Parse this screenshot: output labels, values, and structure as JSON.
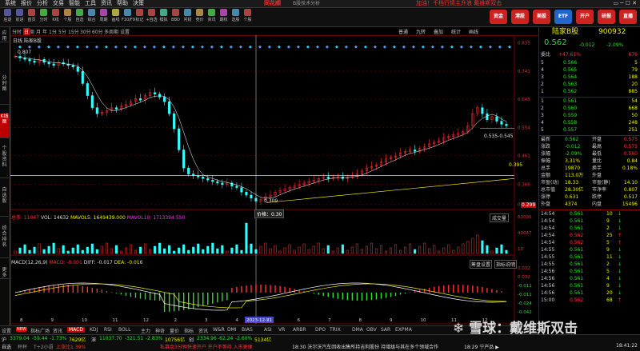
{
  "menubar": {
    "items": [
      "系统",
      "报价",
      "分析",
      "交易",
      "智能",
      "工具",
      "资讯",
      "帮助",
      "决策"
    ],
    "brand": "同花顺",
    "subtitle": "B股技术分析",
    "ad": "加油！千档行情主升浪  戴维斯双击"
  },
  "toolbar": {
    "buttons": [
      {
        "label": "后退",
        "icon": "back-icon"
      },
      {
        "label": "前进",
        "icon": "forward-icon"
      },
      {
        "label": "首页",
        "icon": "home-icon"
      },
      {
        "label": "分时",
        "icon": "timeshare-icon"
      },
      {
        "label": "K线",
        "icon": "kline-icon"
      },
      {
        "label": "个股",
        "icon": "stock-icon"
      },
      {
        "label": "自选",
        "icon": "watchlist-icon"
      },
      {
        "label": "综合",
        "icon": "composite-icon"
      },
      {
        "label": "周期",
        "icon": "period-icon"
      },
      {
        "label": "画线",
        "icon": "draw-icon"
      },
      {
        "label": "F10/F9",
        "icon": "f10-icon"
      },
      {
        "label": "标记",
        "icon": "mark-icon"
      },
      {
        "label": "+自选",
        "icon": "add-watch-icon"
      },
      {
        "label": "模拟",
        "icon": "simulate-icon"
      },
      {
        "label": "BBD",
        "icon": "bbd-icon"
      },
      {
        "label": "问财",
        "icon": "wencai-icon"
      },
      {
        "label": "竞价",
        "icon": "auction-icon"
      },
      {
        "label": "资讯",
        "icon": "news-icon"
      },
      {
        "label": "期权",
        "icon": "option-icon"
      },
      {
        "label": "选股",
        "icon": "select-icon"
      },
      {
        "label": "个股",
        "icon": "stock2-icon"
      }
    ],
    "right_buttons": [
      {
        "label": "资金",
        "color": "#c22"
      },
      {
        "label": "港股",
        "color": "#c22"
      },
      {
        "label": "美股",
        "color": "#c22"
      },
      {
        "label": "ETF",
        "color": "#26c"
      },
      {
        "label": "开户",
        "color": "#c22"
      },
      {
        "label": "研报",
        "color": "#c22"
      },
      {
        "label": "直播",
        "color": "#c22"
      }
    ]
  },
  "sidebar": [
    {
      "label": "应用",
      "active": false
    },
    {
      "label": "分时图",
      "active": false
    },
    {
      "label": "K线图",
      "active": true
    },
    {
      "label": "个股资料",
      "active": false
    },
    {
      "label": "自选股",
      "active": false
    },
    {
      "label": "综合排名",
      "active": false
    },
    {
      "label": "更多",
      "active": false
    }
  ],
  "periods": [
    "分时",
    "日",
    "周",
    "月",
    "年",
    "1分",
    "5分",
    "15分",
    "30分",
    "60分",
    "多周期",
    "设置"
  ],
  "period_active": "日",
  "period_right": [
    "普通",
    "九转",
    "叠加",
    "统计",
    "画线"
  ],
  "main_label": "日线  陆家B股",
  "chart_data": {
    "type": "candlestick",
    "y_ticks": [
      "0.835",
      "0.741",
      "0.648",
      "0.554",
      "0.461",
      "0.366",
      "0.299"
    ],
    "ylim": [
      0.285,
      0.855
    ],
    "x_ticks": [
      "8",
      "9",
      "10",
      "11",
      "12",
      "2",
      "3",
      "4",
      "5",
      "6",
      "7",
      "8",
      "9",
      "10",
      "11",
      "12"
    ],
    "x_tick_years": {
      "2023": 4
    },
    "cursor_date": "2023-12-21",
    "labels": {
      "high_mark": "0.807",
      "low_mark": "0.309",
      "range_text": "0.535-0.545",
      "price_tag": "0.395",
      "low_tag": "0.299"
    },
    "closes": [
      0.79,
      0.785,
      0.78,
      0.775,
      0.77,
      0.78,
      0.77,
      0.765,
      0.76,
      0.77,
      0.765,
      0.76,
      0.755,
      0.74,
      0.7,
      0.66,
      0.62,
      0.6,
      0.605,
      0.61,
      0.62,
      0.615,
      0.625,
      0.63,
      0.64,
      0.65,
      0.645,
      0.66,
      0.67,
      0.665,
      0.655,
      0.64,
      0.6,
      0.55,
      0.48,
      0.42,
      0.4,
      0.395,
      0.39,
      0.385,
      0.38,
      0.375,
      0.37,
      0.365,
      0.37,
      0.36,
      0.355,
      0.34,
      0.33,
      0.32,
      0.31,
      0.315,
      0.325,
      0.33,
      0.34,
      0.345,
      0.35,
      0.355,
      0.36,
      0.365,
      0.37,
      0.375,
      0.38,
      0.385,
      0.39,
      0.385,
      0.39,
      0.39,
      0.385,
      0.39,
      0.395,
      0.4,
      0.41,
      0.42,
      0.425,
      0.43,
      0.44,
      0.45,
      0.455,
      0.46,
      0.47,
      0.475,
      0.48,
      0.475,
      0.485,
      0.49,
      0.5,
      0.505,
      0.51,
      0.52,
      0.525,
      0.53,
      0.535,
      0.54,
      0.56,
      0.6,
      0.62,
      0.6,
      0.58,
      0.59,
      0.575,
      0.565,
      0.56
    ]
  },
  "volume_info": {
    "total": "总手: 11047",
    "vol": "VOL: 14632",
    "mavol5": "MAVOL5: 1649439.000",
    "mavol10": "MAVOL10: 1713394.550",
    "right": "成交量",
    "ticks": [
      "60095",
      "40047",
      "10"
    ]
  },
  "macd_info": {
    "label": "MACD(12,26,9)",
    "macd": "MACD: -0.001",
    "diff": "DIFF: -0.017",
    "dea": "DEA: -0.016",
    "btn1": "筹盘设置",
    "btn2": "指标说明",
    "ticks": [
      "0.032",
      "0.032",
      "-0.011",
      "-0.011",
      "-0.024",
      "-0.042"
    ],
    "cursor_tag": "0.30"
  },
  "bottom_tabs": [
    "设置",
    "NEW",
    "指标广场",
    "资讯",
    "MACD",
    "KDJ",
    "RSI",
    "BOLL",
    "主力",
    "神奇",
    "量价",
    "指标",
    "资讯",
    "W&R",
    "DMI",
    "BIAS",
    "ASI",
    "VR",
    "ARBR",
    "DPO",
    "TRIX",
    "DMA",
    "OBV",
    "SAR",
    "EXPMA"
  ],
  "bottom_active": "MACD",
  "quote": {
    "name": "陆家B股",
    "code": "900932",
    "price": "0.562",
    "change": "-0.012",
    "change_pct": "-2.09%",
    "weibi_label": "委比",
    "weibi": "+47.61%",
    "weicha": "676",
    "sells": [
      {
        "label": "5",
        "price": "0.566",
        "vol": "5"
      },
      {
        "label": "4",
        "price": "0.565",
        "vol": "79"
      },
      {
        "label": "3",
        "price": "0.564",
        "vol": "188"
      },
      {
        "label": "2",
        "price": "0.563",
        "vol": "20"
      },
      {
        "label": "1",
        "price": "0.562",
        "vol": "885"
      }
    ],
    "buys": [
      {
        "label": "1",
        "price": "0.561",
        "vol": "54"
      },
      {
        "label": "2",
        "price": "0.560",
        "vol": "668"
      },
      {
        "label": "3",
        "price": "0.559",
        "vol": "50"
      },
      {
        "label": "4",
        "price": "0.558",
        "vol": "248"
      },
      {
        "label": "5",
        "price": "0.557",
        "vol": "251"
      }
    ],
    "stats": [
      {
        "l1": "最新",
        "v1": "0.562",
        "l2": "开盘",
        "v2": "0.575"
      },
      {
        "l1": "涨跌",
        "v1": "-0.012",
        "l2": "最高",
        "v2": "0.575"
      },
      {
        "l1": "涨幅",
        "v1": "-2.09%",
        "l2": "最低",
        "v2": "0.560"
      },
      {
        "l1": "振幅",
        "v1": "3.31%",
        "l2": "量比",
        "v2": "0.84"
      },
      {
        "l1": "总手",
        "v1": "19870",
        "l2": "换手",
        "v2": "0.18%"
      },
      {
        "l1": "金额",
        "v1": "113.0万",
        "l2": "外盘",
        "v2": ""
      },
      {
        "l1": "市盈(动)",
        "v1": "18.33",
        "l2": "市盈(静)",
        "v2": "14.10"
      },
      {
        "l1": "总市值",
        "v1": "28.30亿",
        "l2": "市净率",
        "v2": "0.807"
      },
      {
        "l1": "涨停",
        "v1": "0.631",
        "l2": "跌停",
        "v2": "0.517"
      },
      {
        "l1": "外盘",
        "v1": "4374",
        "l2": "内盘",
        "v2": "15496"
      }
    ],
    "ticks": [
      {
        "time": "14:54",
        "price": "0.561",
        "vol": "10",
        "dir": "down"
      },
      {
        "time": "14:54",
        "price": "0.561",
        "vol": "9",
        "dir": "down"
      },
      {
        "time": "14:54",
        "price": "0.561",
        "vol": "2",
        "dir": "down"
      },
      {
        "time": "14:54",
        "price": "0.562",
        "vol": "25",
        "dir": "up"
      },
      {
        "time": "14:54",
        "price": "0.562",
        "vol": "5",
        "dir": "up"
      },
      {
        "time": "14:55",
        "price": "0.561",
        "vol": "9",
        "dir": "down"
      },
      {
        "time": "14:55",
        "price": "0.561",
        "vol": "11",
        "dir": "down"
      },
      {
        "time": "14:55",
        "price": "0.561",
        "vol": "2",
        "dir": "down"
      },
      {
        "time": "14:56",
        "price": "0.561",
        "vol": "5",
        "dir": "down"
      },
      {
        "time": "14:56",
        "price": "0.561",
        "vol": "4",
        "dir": "down"
      },
      {
        "time": "14:56",
        "price": "0.561",
        "vol": "9",
        "dir": "down"
      },
      {
        "time": "14:56",
        "price": "0.561",
        "vol": "20",
        "dir": "down"
      },
      {
        "time": "15:00",
        "price": "0.562",
        "vol": "68",
        "dir": "up"
      }
    ],
    "rp_tabs": [
      "分时",
      "个股",
      "资讯"
    ]
  },
  "status": {
    "row1": [
      {
        "t": "沪",
        "c": "white"
      },
      {
        "t": "3379.04",
        "c": "green"
      },
      {
        "t": "-59.44",
        "c": "green"
      },
      {
        "t": "-1.73%",
        "c": "green"
      },
      {
        "t": "7629亿",
        "c": "yellow"
      },
      {
        "t": "深",
        "c": "white"
      },
      {
        "t": "11037.70",
        "c": "green"
      },
      {
        "t": "-321.51",
        "c": "green"
      },
      {
        "t": "-2.83%",
        "c": "green"
      },
      {
        "t": "10756亿",
        "c": "yellow"
      },
      {
        "t": "创",
        "c": "white"
      },
      {
        "t": "2334.96",
        "c": "green"
      },
      {
        "t": "-62.24",
        "c": "green"
      },
      {
        "t": "-2.60%",
        "c": "green"
      },
      {
        "t": "5134亿",
        "c": "yellow"
      }
    ],
    "row2": [
      {
        "t": "自选",
        "c": "white"
      },
      {
        "t": "杯杯",
        "c": "gray"
      },
      {
        "t": "T+2小语",
        "c": "gray"
      },
      {
        "t": "上涨比1.39%",
        "c": "red"
      },
      {
        "t": "私募金3分钟快速开户 开户不等待 入市更便",
        "c": "red"
      },
      {
        "t": "18:30 沃尔沃汽车回收出售所持吉利股份 持增级与其在多个领域合作",
        "c": "white"
      },
      {
        "t": "18:29 宁产品 ▶",
        "c": "white"
      },
      {
        "t": "18:41:22",
        "c": "white"
      }
    ]
  },
  "watermark": "雪球：戴维斯双击"
}
